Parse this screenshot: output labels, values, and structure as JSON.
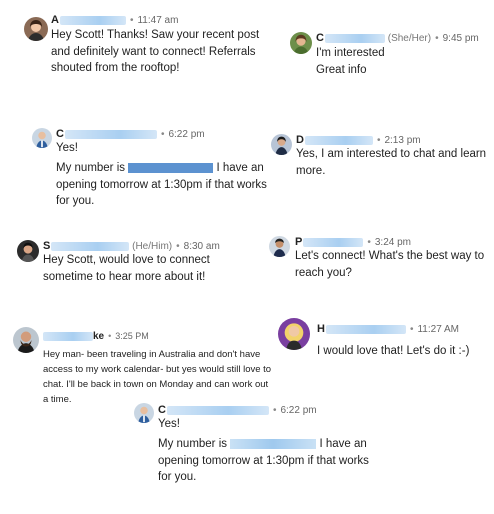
{
  "messages": [
    {
      "name_visible": "A",
      "name_tail": "",
      "pronouns": "",
      "time": "11:47 am",
      "lines": [
        "Hey Scott! Thanks! Saw your recent post",
        "and definitely want to connect! Referrals",
        "shouted from the rooftop!"
      ]
    },
    {
      "name_visible": "C",
      "name_tail": "",
      "pronouns": "(She/Her)",
      "time": "9:45 pm",
      "lines": [
        "I'm interested",
        "Great info"
      ]
    },
    {
      "name_visible": "C",
      "name_tail": "",
      "pronouns": "",
      "time": "6:22 pm",
      "lines": [
        "Yes!"
      ],
      "number_prefix": "My number is",
      "number_suffix": "I have an",
      "lines_after": [
        "opening tomorrow at 1:30pm if that works",
        "for you."
      ]
    },
    {
      "name_visible": "D",
      "name_tail": "",
      "pronouns": "",
      "time": "2:13 pm",
      "lines": [
        "Yes, I am interested to chat and learn",
        "more."
      ]
    },
    {
      "name_visible": "S",
      "name_tail": "",
      "pronouns": "(He/Him)",
      "time": "8:30 am",
      "lines": [
        "Hey Scott, would love to connect",
        "sometime to hear more about it!"
      ]
    },
    {
      "name_visible": "P",
      "name_tail": "",
      "pronouns": "",
      "time": "3:24 pm",
      "lines": [
        "Let's connect! What's the best way to",
        "reach you?"
      ]
    },
    {
      "name_visible": "",
      "name_tail": "ke",
      "pronouns": "",
      "time": "3:25 PM",
      "lines": [
        "Hey man- been traveling in Australia and don't have",
        "access to my work calendar- but yes would still love to",
        "chat. I'll be back in town on Monday and can work out",
        "a time."
      ]
    },
    {
      "name_visible": "H",
      "name_tail": "",
      "pronouns": "",
      "time": "11:27 AM",
      "lines": [
        "I would love that! Let's do it :-)"
      ]
    },
    {
      "name_visible": "C",
      "name_tail": "",
      "pronouns": "",
      "time": "6:22 pm",
      "lines": [
        "Yes!"
      ],
      "number_prefix": "My number is",
      "number_suffix": "I have an",
      "lines_after": [
        "opening tomorrow at 1:30pm if that works",
        "for you."
      ]
    }
  ],
  "separator": "•",
  "colors": {
    "redaction_blue": "#3f7fc8",
    "blur_blue": "#a9cff1"
  }
}
